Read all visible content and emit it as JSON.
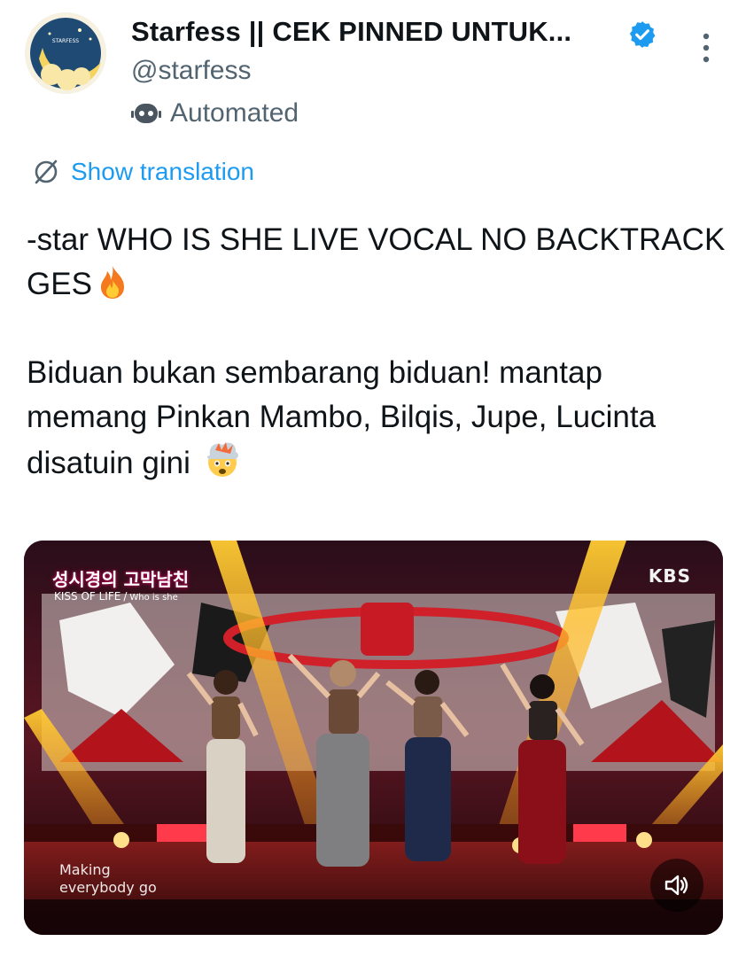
{
  "tweet": {
    "author": {
      "display_name": "Starfess || CEK PINNED UNTUK...",
      "handle": "@starfess",
      "label": "Automated",
      "avatar_text": "STARFESS"
    },
    "translate_label": "Show translation",
    "text_paragraph_1": "-star WHO IS SHE LIVE VOCAL NO BACKTRACK GES",
    "text_paragraph_2": "Biduan bukan sembarang biduan! mantap memang Pinkan Mambo, Bilqis, Jupe, Lucinta disatuin gini",
    "emoji_1": "fire",
    "emoji_2": "exploding-head",
    "media": {
      "show_logo": "성시경의 고막남친",
      "song_artist": "KISS OF LIFE",
      "song_separator": "/",
      "song_title": "Who is she",
      "channel": "KBS",
      "caption_line_1": "Making",
      "caption_line_2": "everybody go"
    }
  },
  "colors": {
    "link": "#1d9bf0",
    "secondary_text": "#536471",
    "primary_text": "#0f1419",
    "verified_badge": "#1d9bf0"
  }
}
